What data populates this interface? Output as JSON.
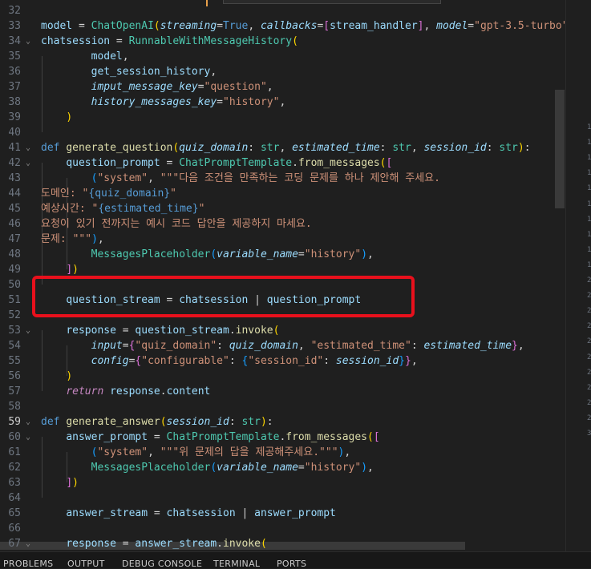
{
  "editor": {
    "lines": [
      {
        "num": "32",
        "code": []
      },
      {
        "num": "33",
        "code": [
          [
            "var",
            "model"
          ],
          [
            "op",
            " = "
          ],
          [
            "cls",
            "ChatOpenAI"
          ],
          [
            "br1",
            "("
          ],
          [
            "param",
            "streaming"
          ],
          [
            "op",
            "="
          ],
          [
            "kw",
            "True"
          ],
          [
            "pn",
            ", "
          ],
          [
            "param",
            "callbacks"
          ],
          [
            "op",
            "="
          ],
          [
            "br2",
            "["
          ],
          [
            "var",
            "stream_handler"
          ],
          [
            "br2",
            "]"
          ],
          [
            "pn",
            ", "
          ],
          [
            "param",
            "model"
          ],
          [
            "op",
            "="
          ],
          [
            "str",
            "\"gpt-3.5-turbo\""
          ],
          [
            "br1",
            ")"
          ]
        ]
      },
      {
        "num": "34",
        "code": [
          [
            "var",
            "chatsession"
          ],
          [
            "op",
            " = "
          ],
          [
            "cls",
            "RunnableWithMessageHistory"
          ],
          [
            "br1",
            "("
          ]
        ]
      },
      {
        "num": "35",
        "code": [
          [
            "pn",
            "        "
          ],
          [
            "var",
            "model"
          ],
          [
            "pn",
            ","
          ]
        ]
      },
      {
        "num": "36",
        "code": [
          [
            "pn",
            "        "
          ],
          [
            "var",
            "get_session_history"
          ],
          [
            "pn",
            ","
          ]
        ]
      },
      {
        "num": "37",
        "code": [
          [
            "pn",
            "        "
          ],
          [
            "param",
            "imput_message_key"
          ],
          [
            "op",
            "="
          ],
          [
            "str",
            "\"question\""
          ],
          [
            "pn",
            ","
          ]
        ]
      },
      {
        "num": "38",
        "code": [
          [
            "pn",
            "        "
          ],
          [
            "param",
            "history_messages_key"
          ],
          [
            "op",
            "="
          ],
          [
            "str",
            "\"history\""
          ],
          [
            "pn",
            ","
          ]
        ]
      },
      {
        "num": "39",
        "code": [
          [
            "pn",
            "    "
          ],
          [
            "br1",
            ")"
          ]
        ]
      },
      {
        "num": "40",
        "code": []
      },
      {
        "num": "41",
        "code": [
          [
            "kw",
            "def "
          ],
          [
            "fn",
            "generate_question"
          ],
          [
            "br1",
            "("
          ],
          [
            "param",
            "quiz_domain"
          ],
          [
            "pn",
            ": "
          ],
          [
            "cls",
            "str"
          ],
          [
            "pn",
            ", "
          ],
          [
            "param",
            "estimated_time"
          ],
          [
            "pn",
            ": "
          ],
          [
            "cls",
            "str"
          ],
          [
            "pn",
            ", "
          ],
          [
            "param",
            "session_id"
          ],
          [
            "pn",
            ": "
          ],
          [
            "cls",
            "str"
          ],
          [
            "br1",
            ")"
          ],
          [
            "pn",
            ":"
          ]
        ]
      },
      {
        "num": "42",
        "code": [
          [
            "pn",
            "    "
          ],
          [
            "var",
            "question_prompt"
          ],
          [
            "op",
            " = "
          ],
          [
            "cls",
            "ChatPromptTemplate"
          ],
          [
            "pn",
            "."
          ],
          [
            "fn",
            "from_messages"
          ],
          [
            "br1",
            "("
          ],
          [
            "br2",
            "["
          ]
        ]
      },
      {
        "num": "43",
        "code": [
          [
            "pn",
            "        "
          ],
          [
            "br3",
            "("
          ],
          [
            "str",
            "\"system\""
          ],
          [
            "pn",
            ", "
          ],
          [
            "str",
            "\"\"\"다음 조건을 만족하는 코딩 문제를 하나 제안해 주세요."
          ]
        ]
      },
      {
        "num": "44",
        "code": [
          [
            "str",
            "도메인: \""
          ],
          [
            "kw",
            "{quiz_domain}"
          ],
          [
            "str",
            "\""
          ]
        ]
      },
      {
        "num": "45",
        "code": [
          [
            "str",
            "예상시간: \""
          ],
          [
            "kw",
            "{estimated_time}"
          ],
          [
            "str",
            "\""
          ]
        ]
      },
      {
        "num": "46",
        "code": [
          [
            "str",
            "요청이 있기 전까지는 예시 코드 답안을 제공하지 마세요."
          ]
        ]
      },
      {
        "num": "47",
        "code": [
          [
            "str",
            "문제: \"\"\""
          ],
          [
            "br3",
            ")"
          ],
          [
            "pn",
            ","
          ]
        ]
      },
      {
        "num": "48",
        "code": [
          [
            "pn",
            "        "
          ],
          [
            "cls",
            "MessagesPlaceholder"
          ],
          [
            "br3",
            "("
          ],
          [
            "param",
            "variable_name"
          ],
          [
            "op",
            "="
          ],
          [
            "str",
            "\"history\""
          ],
          [
            "br3",
            ")"
          ],
          [
            "pn",
            ","
          ]
        ]
      },
      {
        "num": "49",
        "code": [
          [
            "pn",
            "    "
          ],
          [
            "br2",
            "]"
          ],
          [
            "br1",
            ")"
          ]
        ]
      },
      {
        "num": "50",
        "code": []
      },
      {
        "num": "51",
        "code": [
          [
            "pn",
            "    "
          ],
          [
            "var",
            "question_stream"
          ],
          [
            "op",
            " = "
          ],
          [
            "var",
            "chatsession"
          ],
          [
            "op",
            " | "
          ],
          [
            "var",
            "question_prompt"
          ]
        ]
      },
      {
        "num": "52",
        "code": []
      },
      {
        "num": "53",
        "code": [
          [
            "pn",
            "    "
          ],
          [
            "var",
            "response"
          ],
          [
            "op",
            " = "
          ],
          [
            "var",
            "question_stream"
          ],
          [
            "pn",
            "."
          ],
          [
            "fn",
            "invoke"
          ],
          [
            "br1",
            "("
          ]
        ]
      },
      {
        "num": "54",
        "code": [
          [
            "pn",
            "        "
          ],
          [
            "param",
            "input"
          ],
          [
            "op",
            "="
          ],
          [
            "br2",
            "{"
          ],
          [
            "str",
            "\"quiz_domain\""
          ],
          [
            "pn",
            ": "
          ],
          [
            "param",
            "quiz_domain"
          ],
          [
            "pn",
            ", "
          ],
          [
            "str",
            "\"estimated_time\""
          ],
          [
            "pn",
            ": "
          ],
          [
            "param",
            "estimated_time"
          ],
          [
            "br2",
            "}"
          ],
          [
            "pn",
            ","
          ]
        ]
      },
      {
        "num": "55",
        "code": [
          [
            "pn",
            "        "
          ],
          [
            "param",
            "config"
          ],
          [
            "op",
            "="
          ],
          [
            "br2",
            "{"
          ],
          [
            "str",
            "\"configurable\""
          ],
          [
            "pn",
            ": "
          ],
          [
            "br3",
            "{"
          ],
          [
            "str",
            "\"session_id\""
          ],
          [
            "pn",
            ": "
          ],
          [
            "param",
            "session_id"
          ],
          [
            "br3",
            "}"
          ],
          [
            "br2",
            "}"
          ],
          [
            "pn",
            ","
          ]
        ]
      },
      {
        "num": "56",
        "code": [
          [
            "pn",
            "    "
          ],
          [
            "br1",
            ")"
          ]
        ]
      },
      {
        "num": "57",
        "code": [
          [
            "pn",
            "    "
          ],
          [
            "ctl",
            "return "
          ],
          [
            "var",
            "response"
          ],
          [
            "pn",
            "."
          ],
          [
            "var",
            "content"
          ]
        ]
      },
      {
        "num": "58",
        "code": []
      },
      {
        "num": "59",
        "code": [
          [
            "kw",
            "def "
          ],
          [
            "fn",
            "generate_answer"
          ],
          [
            "br1",
            "("
          ],
          [
            "param",
            "session_id"
          ],
          [
            "pn",
            ": "
          ],
          [
            "cls",
            "str"
          ],
          [
            "br1",
            ")"
          ],
          [
            "pn",
            ":"
          ]
        ]
      },
      {
        "num": "60",
        "code": [
          [
            "pn",
            "    "
          ],
          [
            "var",
            "answer_prompt"
          ],
          [
            "op",
            " = "
          ],
          [
            "cls",
            "ChatPromptTemplate"
          ],
          [
            "pn",
            "."
          ],
          [
            "fn",
            "from_messages"
          ],
          [
            "br1",
            "("
          ],
          [
            "br2",
            "["
          ]
        ]
      },
      {
        "num": "61",
        "code": [
          [
            "pn",
            "        "
          ],
          [
            "br3",
            "("
          ],
          [
            "str",
            "\"system\""
          ],
          [
            "pn",
            ", "
          ],
          [
            "str",
            "\"\"\"위 문제의 답을 제공해주세요.\"\"\""
          ],
          [
            "br3",
            ")"
          ],
          [
            "pn",
            ","
          ]
        ]
      },
      {
        "num": "62",
        "code": [
          [
            "pn",
            "        "
          ],
          [
            "cls",
            "MessagesPlaceholder"
          ],
          [
            "br3",
            "("
          ],
          [
            "param",
            "variable_name"
          ],
          [
            "op",
            "="
          ],
          [
            "str",
            "\"history\""
          ],
          [
            "br3",
            ")"
          ],
          [
            "pn",
            ","
          ]
        ]
      },
      {
        "num": "63",
        "code": [
          [
            "pn",
            "    "
          ],
          [
            "br2",
            "]"
          ],
          [
            "br1",
            ")"
          ]
        ]
      },
      {
        "num": "64",
        "code": []
      },
      {
        "num": "65",
        "code": [
          [
            "pn",
            "    "
          ],
          [
            "var",
            "answer_stream"
          ],
          [
            "op",
            " = "
          ],
          [
            "var",
            "chatsession"
          ],
          [
            "op",
            " | "
          ],
          [
            "var",
            "answer_prompt"
          ]
        ]
      },
      {
        "num": "66",
        "code": []
      },
      {
        "num": "67",
        "code": [
          [
            "pn",
            "    "
          ],
          [
            "var",
            "response"
          ],
          [
            "op",
            " = "
          ],
          [
            "var",
            "answer_stream"
          ],
          [
            "pn",
            "."
          ],
          [
            "fn",
            "invoke"
          ],
          [
            "br1",
            "("
          ]
        ]
      }
    ],
    "active_line": "59",
    "fold_lines": [
      "34",
      "41",
      "42",
      "53",
      "59",
      "60",
      "67"
    ]
  },
  "minimap": {
    "line_numbers": [
      "1",
      "1",
      "1",
      "1",
      "1",
      "1",
      "1",
      "1",
      "1",
      "1",
      "2",
      "2",
      "2",
      "2",
      "2",
      "2",
      "2",
      "2",
      "2",
      "2",
      "3"
    ]
  },
  "panel": {
    "tabs": [
      "PROBLEMS",
      "OUTPUT",
      "DEBUG CONSOLE",
      "TERMINAL",
      "PORTS"
    ]
  },
  "colors": {
    "highlight_box": "#e8101c",
    "background": "#1f1f1f"
  }
}
